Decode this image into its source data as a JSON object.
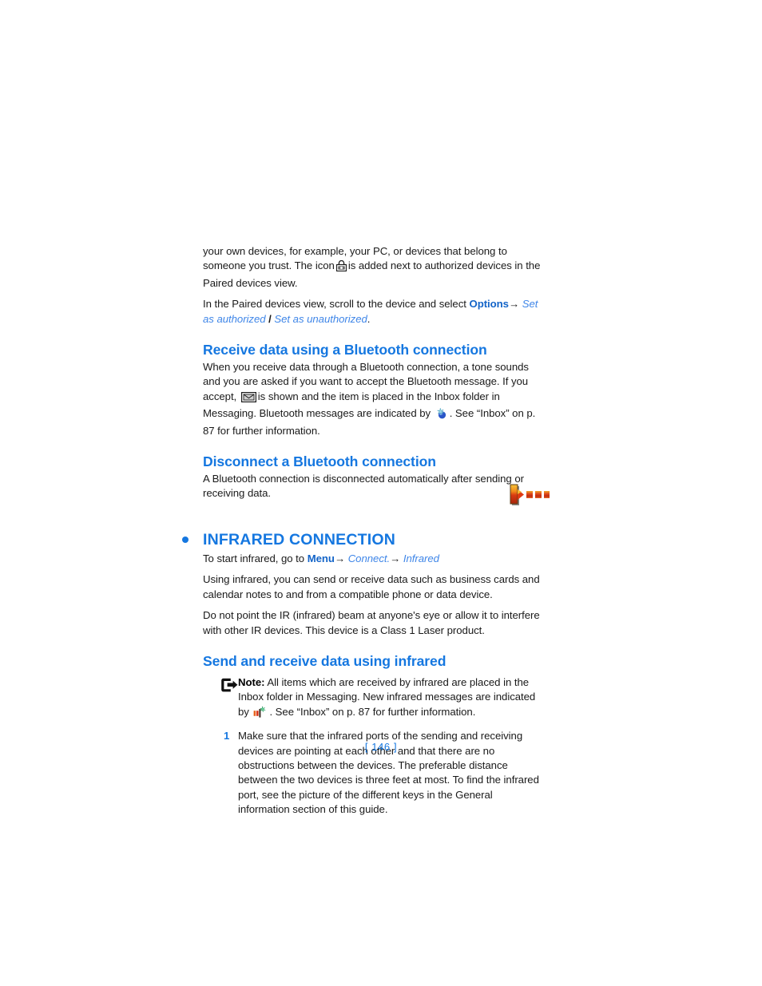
{
  "document": {
    "page_label": "[ 146 ]",
    "accent_color": "#1577e0",
    "link_italic_color": "#3f86e8",
    "body_color": "#1a1a1a"
  },
  "paragraphs": {
    "intro_1": "your own devices, for example, your PC, or devices that belong to someone you trust. The icon",
    "intro_1_cont": "is added next to authorized devices in the Paired devices view.",
    "intro_2_pre": "In the Paired devices view, scroll to the device and select",
    "intro_2_options": "Options",
    "intro_2_arrow": "→",
    "intro_2_set_as_authorized": "Set as authorized",
    "intro_2_separator": "/",
    "intro_2_set_as_unauthorized": "Set as unauthorized",
    "intro_2_period": "."
  },
  "sections": {
    "receive": {
      "heading": "Receive data using a Bluetooth connection",
      "body_1": "When you receive data through a Bluetooth connection, a tone sounds and you are asked if you want to accept the Bluetooth message. If you accept,",
      "body_2": "is shown and the item is placed in the Inbox folder in Messaging. Bluetooth messages are indicated by",
      "body_3": ". See “Inbox” on p. 87 for further information."
    },
    "disconnect": {
      "heading": "Disconnect a Bluetooth connection",
      "body": "A Bluetooth connection is disconnected automatically after sending or receiving data."
    },
    "infrared": {
      "title": "INFRARED CONNECTION",
      "start_pre": "To start infrared, go to",
      "start_menu": "Menu",
      "start_arrow_1": "→",
      "start_connect": "Connect.",
      "start_arrow_2": "→",
      "start_infrared": "Infrared",
      "body_1": "Using infrared, you can send or receive data such as business cards and calendar notes to and from a compatible phone or data device.",
      "body_2": "Do not point the IR (infrared) beam at anyone's eye or allow it to interfere with other IR devices. This device is a Class 1 Laser product."
    },
    "send_receive": {
      "heading": "Send and receive data using infrared",
      "note_label": "Note:",
      "note_text_1": "All items which are received by infrared are placed in the Inbox folder in Messaging. New infrared messages are indicated by",
      "note_text_2": ". See “Inbox” on p. 87 for further information.",
      "step_1_number": "1",
      "step_1_text": "Make sure that the infrared ports of the sending and receiving devices are pointing at each other and that there are no obstructions between the devices. The preferable distance between the two devices is three feet at most. To find the infrared port, see the picture of the different keys in the General information section of this guide."
    }
  },
  "icons": {
    "padlock": "padlock-icon",
    "envelope": "envelope-icon",
    "bluetooth_message": "bluetooth-message-icon",
    "infrared_message": "infrared-message-icon",
    "note": "note-arrow-icon",
    "infrared_connection": "infrared-connection-icon"
  }
}
